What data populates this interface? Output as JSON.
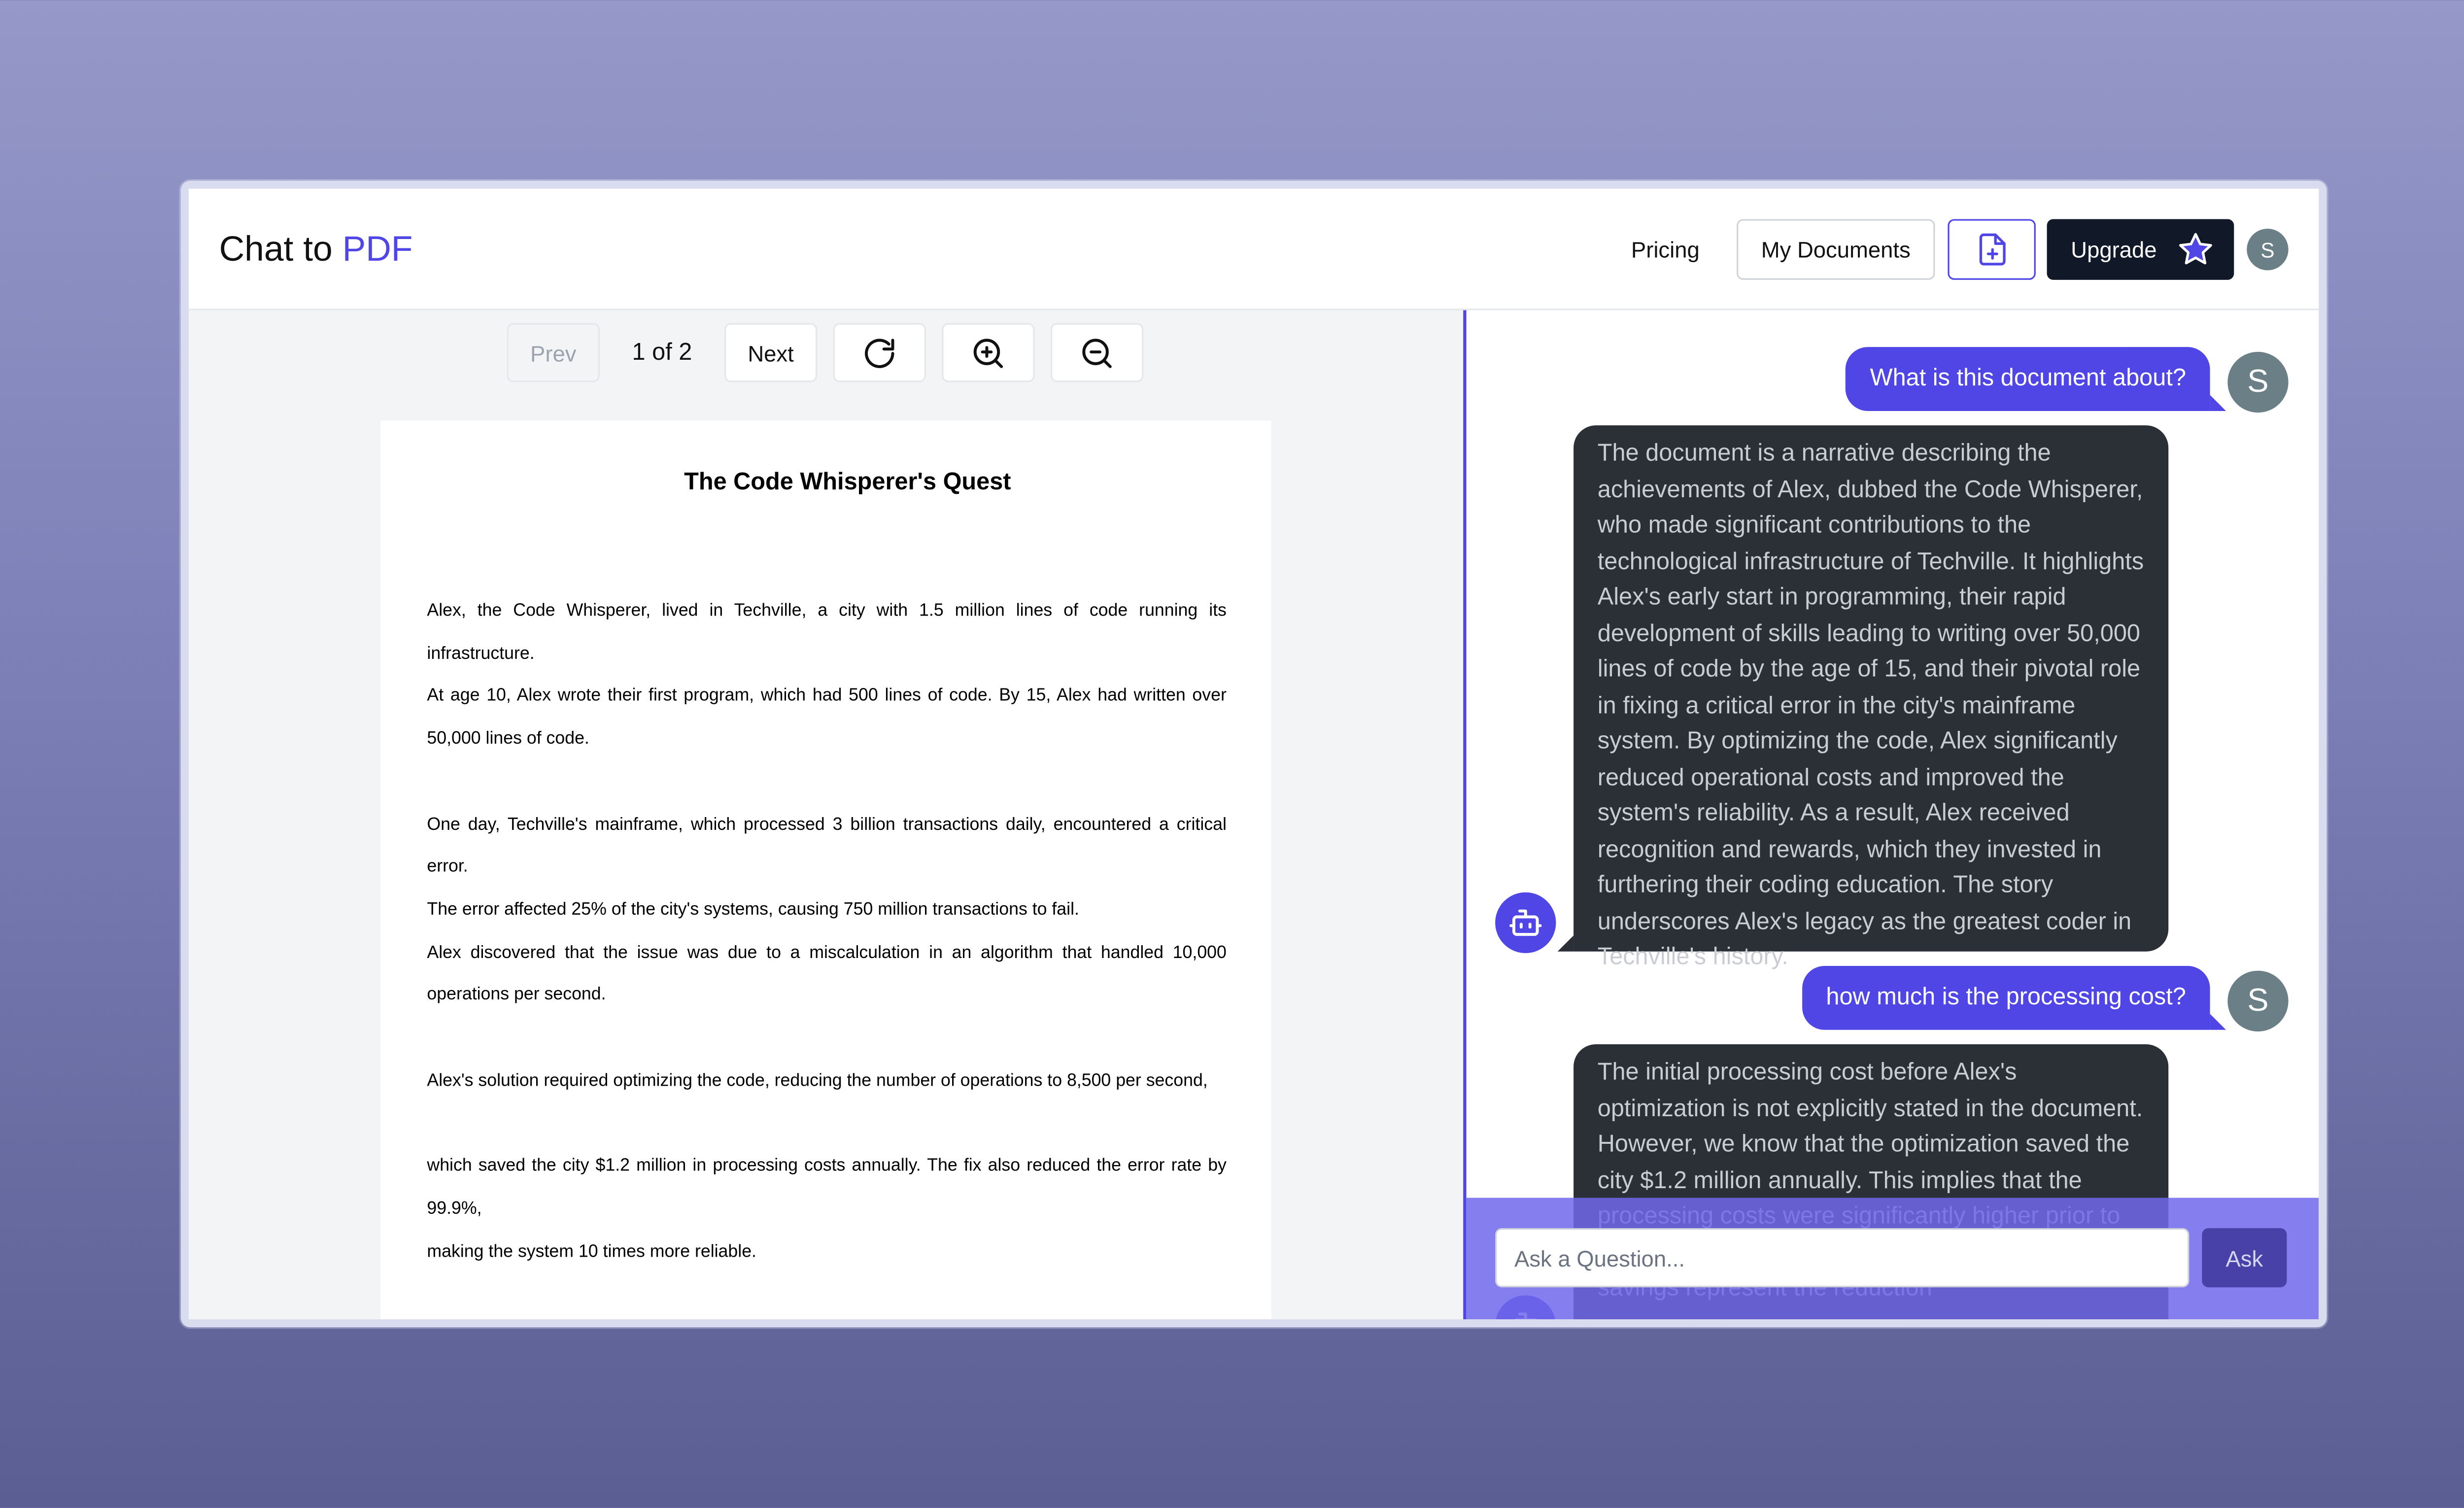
{
  "header": {
    "logo_main": "Chat to",
    "logo_accent": "PDF",
    "pricing": "Pricing",
    "my_documents": "My Documents",
    "upgrade": "Upgrade",
    "avatar_initial": "S"
  },
  "toolbar": {
    "prev": "Prev",
    "page_indicator": "1 of 2",
    "next": "Next"
  },
  "pdf": {
    "title": "The Code Whisperer's Quest",
    "paragraphs": [
      "Alex, the Code Whisperer, lived in Techville, a city with 1.5 million lines of code running its infrastructure.",
      "At age 10, Alex wrote their first program, which had 500 lines of code. By 15, Alex had written over 50,000 lines of code.",
      "One day, Techville's mainframe, which processed 3 billion transactions daily, encountered a critical error.",
      "The error affected 25% of the city's systems, causing 750 million transactions to fail.",
      "Alex discovered that the issue was due to a miscalculation in an algorithm that handled 10,000 operations per second.",
      "Alex's solution required optimizing the code, reducing the number of operations to 8,500 per second,",
      "which saved the city $1.2 million in processing costs annually. The fix also reduced the error rate by 99.9%,",
      "making the system 10 times more reliable."
    ]
  },
  "chat": {
    "user_initial": "S",
    "messages": [
      {
        "role": "user",
        "text": "What is this document about?"
      },
      {
        "role": "assistant",
        "text": "The document is a narrative describing the achievements of Alex, dubbed the Code Whisperer, who made significant contributions to the technological infrastructure of Techville. It highlights Alex's early start in programming, their rapid development of skills leading to writing over 50,000 lines of code by the age of 15, and their pivotal role in fixing a critical error in the city's mainframe system. By optimizing the code, Alex significantly reduced operational costs and improved the system's reliability. As a result, Alex received recognition and rewards, which they invested in furthering their coding education. The story underscores Alex's legacy as the greatest coder in Techville's history."
      },
      {
        "role": "user",
        "text": "how much is the processing cost?"
      },
      {
        "role": "assistant",
        "text": "The initial processing cost before Alex's optimization is not explicitly stated in the document. However, we know that the optimization saved the city $1.2 million annually. This implies that the processing costs were significantly higher prior to Alex's enhancements. ... only deduce that the savings represent the reduction"
      }
    ],
    "input_placeholder": "Ask a Question...",
    "ask_button": "Ask"
  },
  "colors": {
    "accent": "#4f46e5",
    "bot_bubble": "#2b2f36",
    "dark_button": "#111827"
  }
}
